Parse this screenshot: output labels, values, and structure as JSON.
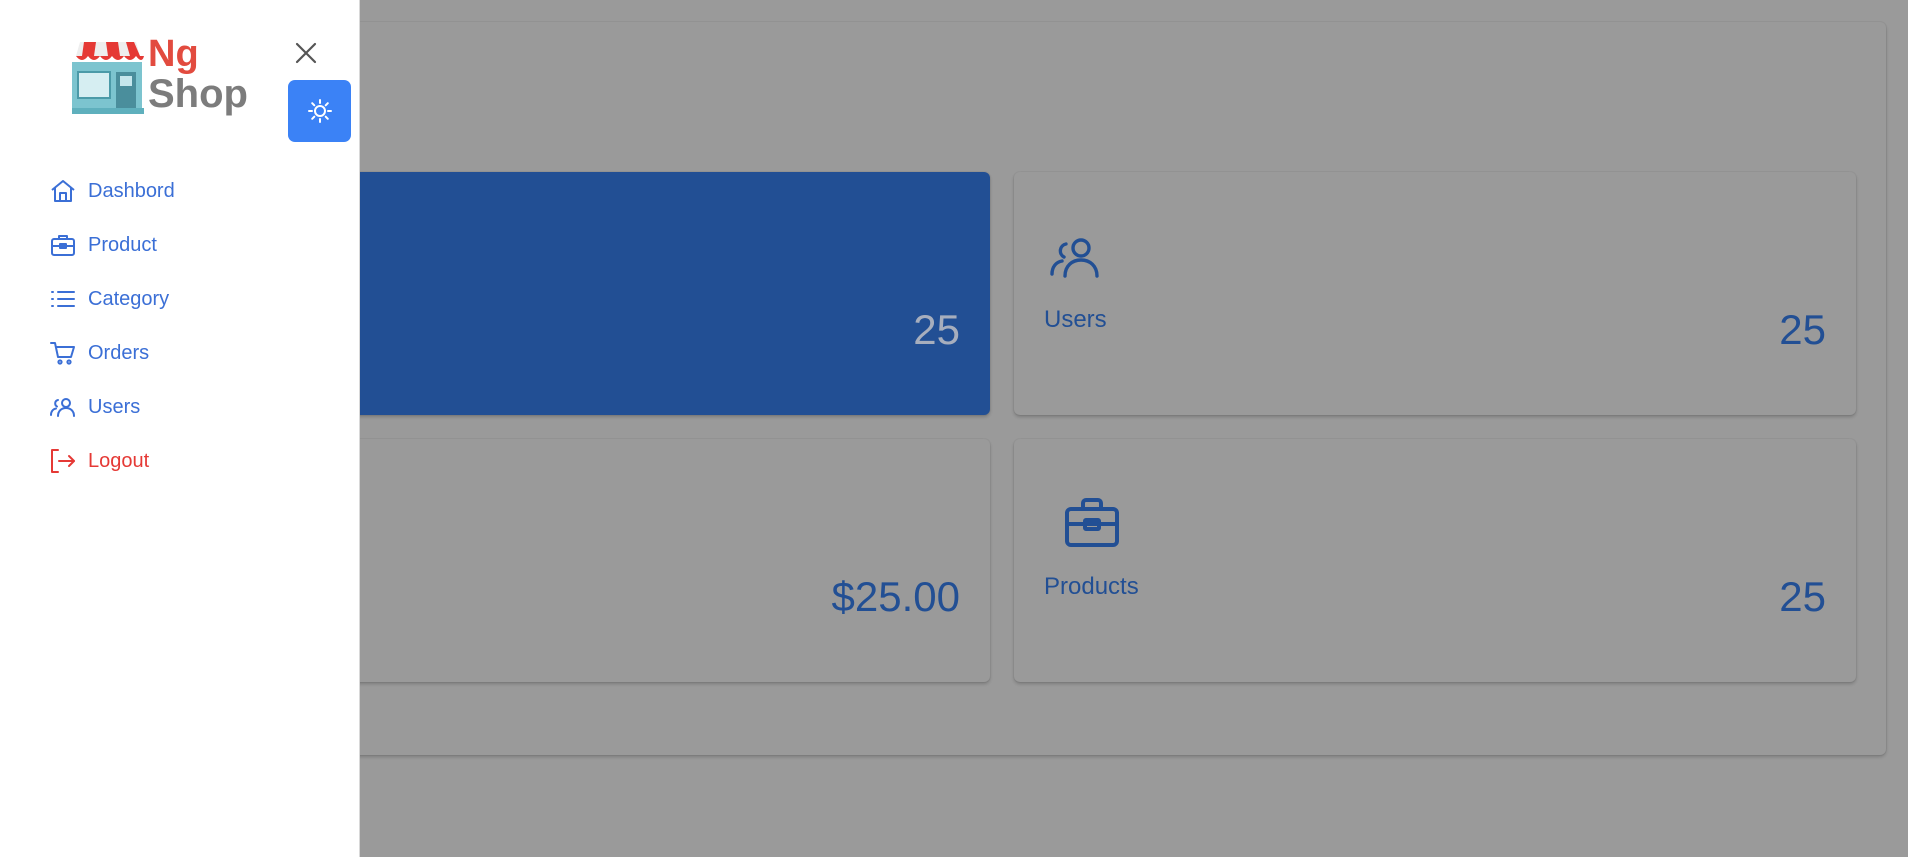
{
  "brand": {
    "line1": "Ng",
    "line2": "Shop"
  },
  "sidebar": {
    "items": [
      {
        "label": "Dashbord",
        "icon": "home-icon"
      },
      {
        "label": "Product",
        "icon": "briefcase-icon"
      },
      {
        "label": "Category",
        "icon": "list-icon"
      },
      {
        "label": "Orders",
        "icon": "cart-icon"
      },
      {
        "label": "Users",
        "icon": "users-icon"
      },
      {
        "label": "Logout",
        "icon": "logout-icon"
      }
    ]
  },
  "cards": [
    {
      "label": "",
      "value": "25",
      "highlight": true
    },
    {
      "label": "Users",
      "value": "25",
      "icon": "users-icon"
    },
    {
      "label": "",
      "value": "$25.00"
    },
    {
      "label": "Products",
      "value": "25",
      "icon": "briefcase-icon"
    }
  ],
  "colors": {
    "accent": "#3b82f6",
    "primary_card": "#224f94",
    "nav_text": "#3b6fd6",
    "logout": "#e53935",
    "overlay": "#9a9a9a"
  }
}
